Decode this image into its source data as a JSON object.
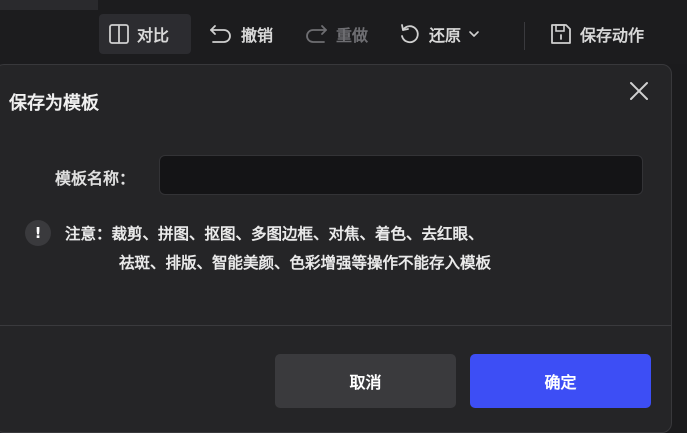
{
  "toolbar": {
    "compare_label": "对比",
    "undo_label": "撤销",
    "redo_label": "重做",
    "restore_label": "还原",
    "save_action_label": "保存动作"
  },
  "dialog": {
    "title": "保存为模板",
    "field_label": "模板名称：",
    "name_value": "",
    "note_icon": "!",
    "note_line1": "注意：裁剪、拼图、抠图、多图边框、对焦、着色、去红眼、",
    "note_line2": "祛斑、排版、智能美颜、色彩增强等操作不能存入模板",
    "cancel_label": "取消",
    "ok_label": "确定"
  },
  "colors": {
    "accent": "#3d4ef5",
    "background": "#252527",
    "input_bg": "#141416"
  }
}
